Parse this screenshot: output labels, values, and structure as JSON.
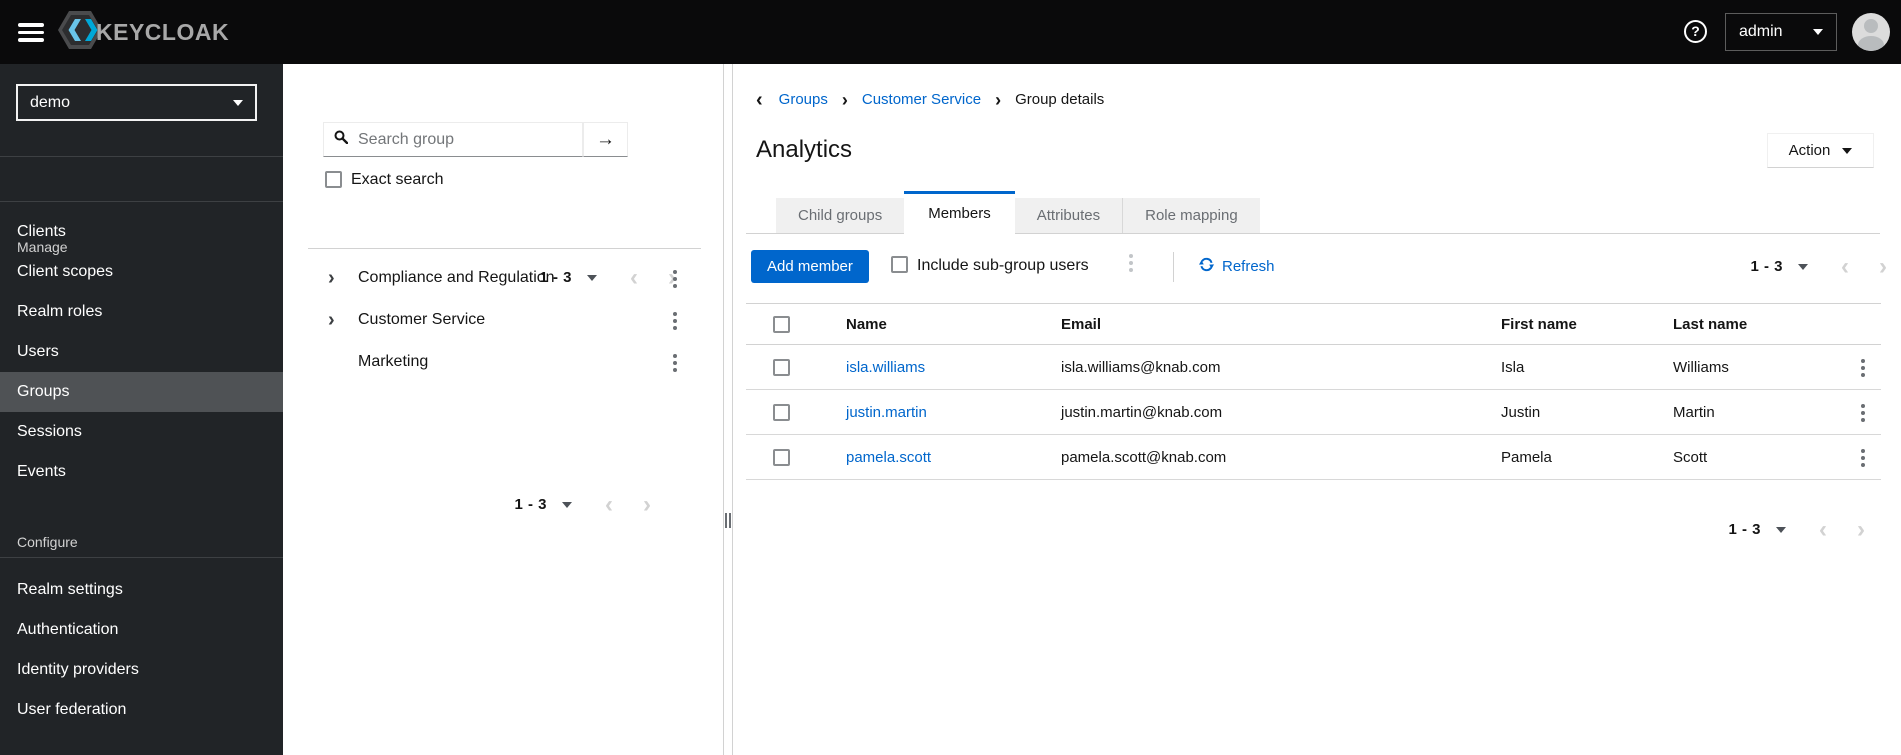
{
  "masthead": {
    "brand": "KEYCLOAK",
    "user": "admin"
  },
  "glyphs": {
    "question": "?",
    "arrow_right": "→",
    "chevron_left": "‹",
    "chevron_right": "›",
    "breadcrumb_back": "‹",
    "breadcrumb_sep": "›",
    "expander": "›"
  },
  "colors": {
    "accent": "#0066cc",
    "link": "#0066cc",
    "masthead_bg": "#0a0a0b",
    "sidebar_bg": "#212427",
    "sidebar_active_bg": "#4f5255"
  },
  "sidebar": {
    "realm": "demo",
    "sections": [
      {
        "label": "Manage",
        "items": [
          "Clients",
          "Client scopes",
          "Realm roles",
          "Users",
          "Groups",
          "Sessions",
          "Events"
        ],
        "active": "Groups"
      },
      {
        "label": "Configure",
        "items": [
          "Realm settings",
          "Authentication",
          "Identity providers",
          "User federation"
        ]
      }
    ]
  },
  "tree_panel": {
    "search_placeholder": "Search group",
    "exact_search": "Exact search",
    "pagination_range": "1 - 3",
    "groups": [
      {
        "name": "Compliance and Regulation",
        "expandable": true
      },
      {
        "name": "Customer Service",
        "expandable": true
      },
      {
        "name": "Marketing",
        "expandable": false
      }
    ]
  },
  "main": {
    "breadcrumb": [
      "Groups",
      "Customer Service",
      "Group details"
    ],
    "title": "Analytics",
    "action": "Action",
    "tabs": [
      {
        "label": "Child groups",
        "active": false
      },
      {
        "label": "Members",
        "active": true
      },
      {
        "label": "Attributes",
        "active": false
      },
      {
        "label": "Role mapping",
        "active": false
      }
    ],
    "toolbar": {
      "add_member": "Add member",
      "include_subgroups": "Include sub-group users",
      "refresh": "Refresh",
      "pagination_range": "1 - 3"
    },
    "table": {
      "headers": [
        "Name",
        "Email",
        "First name",
        "Last name"
      ],
      "rows": [
        {
          "name": "isla.williams",
          "email": "isla.williams@knab.com",
          "first": "Isla",
          "last": "Williams"
        },
        {
          "name": "justin.martin",
          "email": "justin.martin@knab.com",
          "first": "Justin",
          "last": "Martin"
        },
        {
          "name": "pamela.scott",
          "email": "pamela.scott@knab.com",
          "first": "Pamela",
          "last": "Scott"
        }
      ]
    },
    "bottom_pagination_range": "1 - 3"
  }
}
